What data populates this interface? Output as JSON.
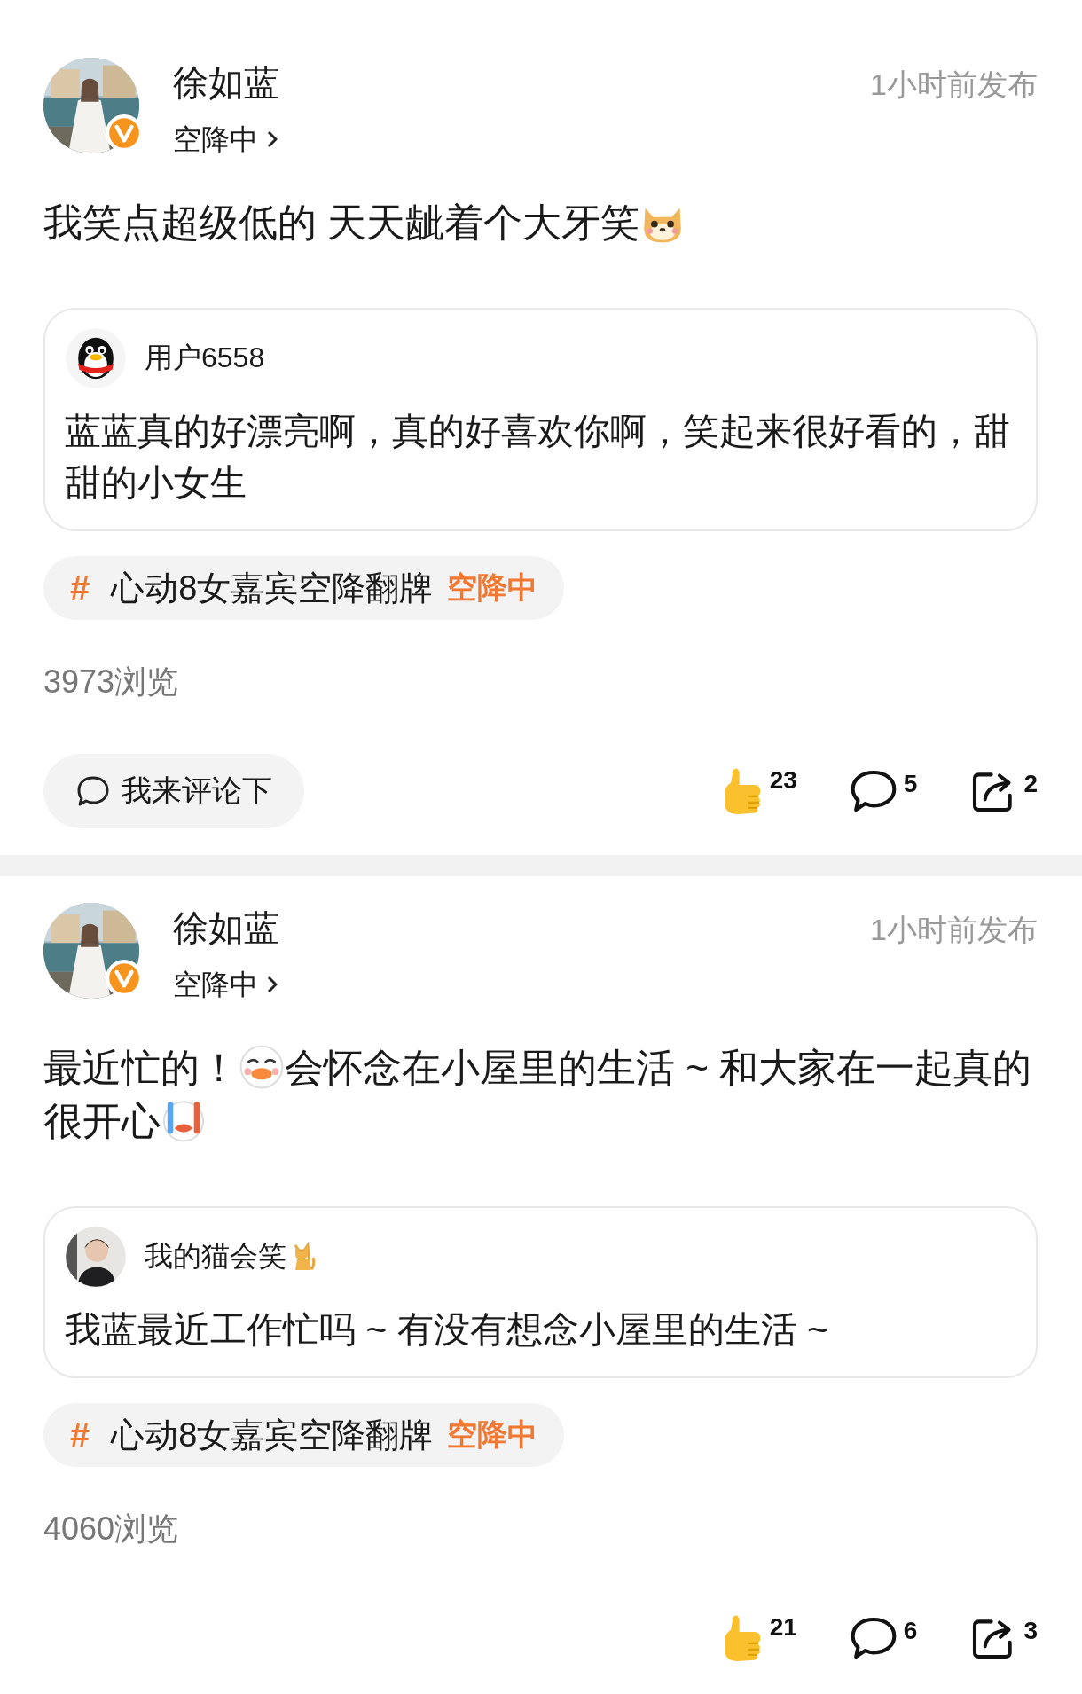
{
  "posts": [
    {
      "author": "徐如蓝",
      "status": "空降中",
      "time": "1小时前发布",
      "content": [
        {
          "kind": "text",
          "text": "我笑点超级低的 天天龇着个大牙笑"
        },
        {
          "kind": "dog"
        }
      ],
      "quote": {
        "avatar": {
          "kind": "penguin"
        },
        "user": [
          {
            "kind": "text",
            "text": "用户6558"
          }
        ],
        "text": "蓝蓝真的好漂亮啊，真的好喜欢你啊，笑起来很好看的，甜甜的小女生"
      },
      "topic": {
        "hash": "#",
        "title": "心动8女嘉宾空降翻牌",
        "tag": "空降中"
      },
      "views": "3973浏览",
      "comment_button": "我来评论下",
      "likes": "23",
      "comments": "5",
      "shares": "2"
    },
    {
      "author": "徐如蓝",
      "status": "空降中",
      "time": "1小时前发布",
      "content": [
        {
          "kind": "text",
          "text": "最近忙的！"
        },
        {
          "kind": "duck"
        },
        {
          "kind": "text",
          "text": "会怀念在小屋里的生活 ~ 和大家在一起真的很开心"
        },
        {
          "kind": "crying"
        }
      ],
      "quote": {
        "user": [
          {
            "kind": "text",
            "text": "我的猫会笑"
          },
          {
            "kind": "cat"
          }
        ],
        "text": "我蓝最近工作忙吗 ~ 有没有想念小屋里的生活 ~"
      },
      "topic": {
        "hash": "#",
        "title": "心动8女嘉宾空降翻牌",
        "tag": "空降中"
      },
      "views": "4060浏览",
      "likes": "21",
      "comments": "6",
      "shares": "3"
    }
  ]
}
